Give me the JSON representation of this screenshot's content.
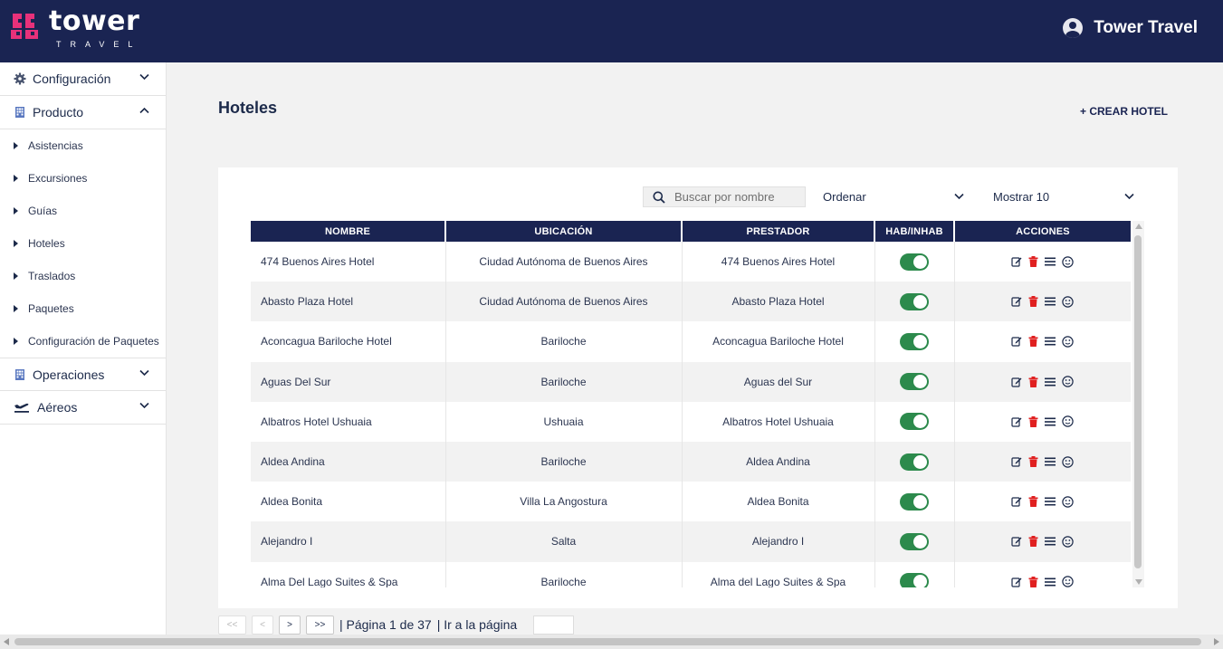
{
  "brand": {
    "name": "tower",
    "sub": "TRAVEL"
  },
  "header": {
    "user_name": "Tower Travel"
  },
  "sidebar": {
    "sections": [
      {
        "label": "Configuración",
        "icon": "gear-icon",
        "expanded": false
      },
      {
        "label": "Producto",
        "icon": "building-icon",
        "expanded": true
      },
      {
        "label": "Operaciones",
        "icon": "building-icon",
        "expanded": false
      },
      {
        "label": "Aéreos",
        "icon": "plane-icon",
        "expanded": false
      }
    ],
    "producto_items": [
      "Asistencias",
      "Excursiones",
      "Guías",
      "Hoteles",
      "Traslados",
      "Paquetes",
      "Configuración de Paquetes"
    ]
  },
  "main": {
    "title": "Hoteles",
    "create_label": "+ CREAR HOTEL",
    "search_placeholder": "Buscar por nombre",
    "order_label": "Ordenar",
    "show_label": "Mostrar 10"
  },
  "table": {
    "columns": [
      "NOMBRE",
      "UBICACIÓN",
      "PRESTADOR",
      "HAB/INHAB",
      "ACCIONES"
    ],
    "rows": [
      {
        "nombre": "474 Buenos Aires Hotel",
        "ubicacion": "Ciudad Autónoma de Buenos Aires",
        "prestador": "474 Buenos Aires Hotel",
        "habilitado": true
      },
      {
        "nombre": "Abasto Plaza Hotel",
        "ubicacion": "Ciudad Autónoma de Buenos Aires",
        "prestador": "Abasto Plaza Hotel",
        "habilitado": true
      },
      {
        "nombre": "Aconcagua Bariloche Hotel",
        "ubicacion": "Bariloche",
        "prestador": "Aconcagua Bariloche Hotel",
        "habilitado": true
      },
      {
        "nombre": "Aguas Del Sur",
        "ubicacion": "Bariloche",
        "prestador": "Aguas del Sur",
        "habilitado": true
      },
      {
        "nombre": "Albatros Hotel Ushuaia",
        "ubicacion": "Ushuaia",
        "prestador": "Albatros Hotel Ushuaia",
        "habilitado": true
      },
      {
        "nombre": "Aldea Andina",
        "ubicacion": "Bariloche",
        "prestador": "Aldea Andina",
        "habilitado": true
      },
      {
        "nombre": "Aldea Bonita",
        "ubicacion": "Villa La Angostura",
        "prestador": "Aldea Bonita",
        "habilitado": true
      },
      {
        "nombre": "Alejandro I",
        "ubicacion": "Salta",
        "prestador": "Alejandro I",
        "habilitado": true
      },
      {
        "nombre": "Alma Del Lago Suites & Spa",
        "ubicacion": "Bariloche",
        "prestador": "Alma del Lago Suites & Spa",
        "habilitado": true
      }
    ]
  },
  "pagination": {
    "first": "<<",
    "prev": "<",
    "next": ">",
    "last": ">>",
    "page_info": "| Página 1 de 37",
    "goto_label": "| Ir a la página"
  },
  "colors": {
    "navy": "#1a2452",
    "toggle_on": "#2c8a4c",
    "delete": "#e02020",
    "brand_pink": "#e8317a"
  }
}
